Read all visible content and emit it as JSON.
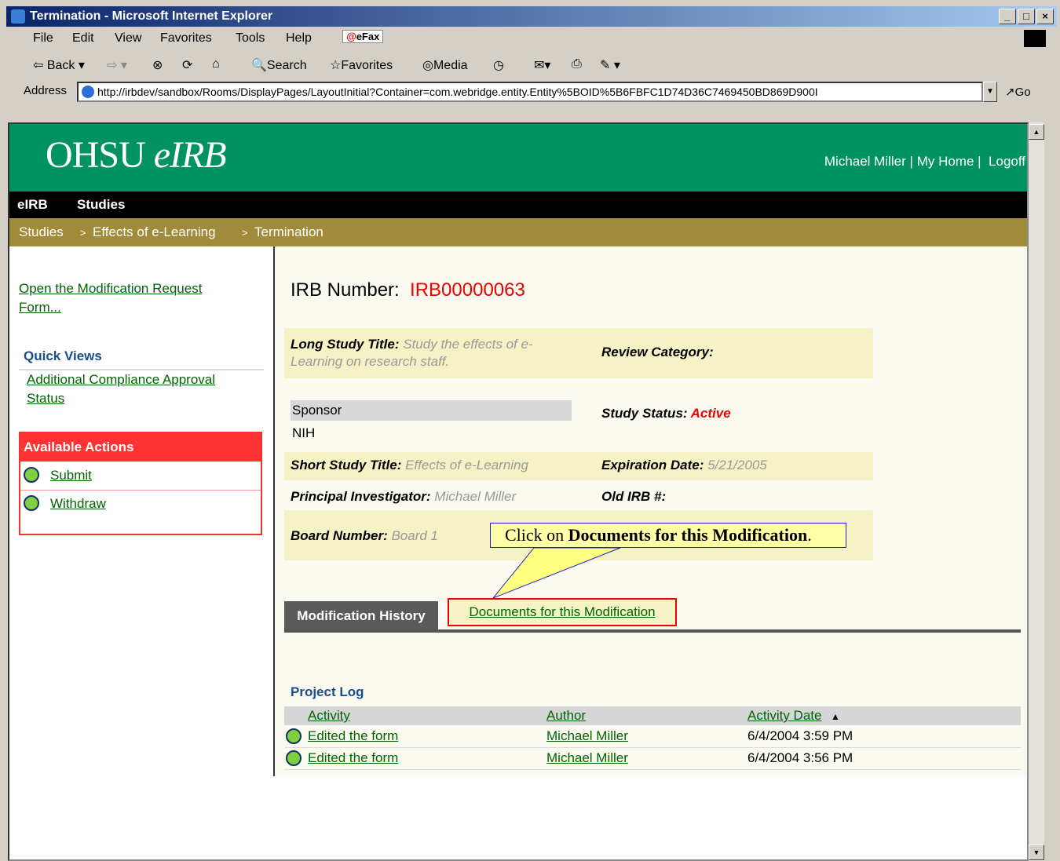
{
  "window": {
    "title": "Termination - Microsoft Internet Explorer"
  },
  "menu": [
    "File",
    "Edit",
    "View",
    "Favorites",
    "Tools",
    "Help"
  ],
  "efax_label": "eFax",
  "toolbar": {
    "back": "Back",
    "search": "Search",
    "favorites": "Favorites",
    "media": "Media"
  },
  "address": {
    "label": "Address",
    "url": "http://irbdev/sandbox/Rooms/DisplayPages/LayoutInitial?Container=com.webridge.entity.Entity%5BOID%5B6FBFC1D74D36C7469450BD869D900I",
    "go": "Go"
  },
  "site": {
    "logo_main": "OHSU",
    "logo_italic": "eIRB",
    "user": "Michael Miller",
    "myhome": "My Home",
    "sep1": "|",
    "sep2": "|",
    "logoff": "Logoff"
  },
  "nav": {
    "item1": "eIRB",
    "item2": "Studies"
  },
  "breadcrumb": {
    "a": "Studies",
    "b": "Effects of e-Learning",
    "c": "Termination",
    "sep": ">"
  },
  "left": {
    "mod_link": "Open the Modification Request Form...",
    "quick_views": "Quick Views",
    "quick_link": "Additional Compliance Approval Status",
    "available_actions": "Available Actions",
    "actions": [
      "Submit",
      "Withdraw"
    ]
  },
  "main": {
    "irb_label": "IRB Number:",
    "irb_value": "IRB00000063",
    "long_title_label": "Long Study Title:",
    "long_title_value": "Study the effects of e-Learning on research staff.",
    "review_category": "Review Category:",
    "sponsor_label": "Sponsor",
    "sponsor_value": "NIH",
    "study_status_label": "Study Status:",
    "study_status_value": "Active",
    "short_title_label": "Short Study Title:",
    "short_title_value": "Effects of e-Learning",
    "expiration_label": "Expiration Date:",
    "expiration_value": "5/21/2005",
    "pi_label": "Principal Investigator:",
    "pi_value": "Michael  Miller",
    "old_irb_label": "Old IRB #:",
    "board_label": "Board Number:",
    "board_value": "Board 1",
    "callout_pre": "Click on ",
    "callout_bold": "Documents for this Modification",
    "callout_post": ".",
    "tab_history": "Modification History",
    "tab_docs": "Documents for this Modification",
    "project_log": "Project Log",
    "log_headers": [
      "Activity",
      "Author",
      "Activity Date"
    ],
    "log_rows": [
      {
        "activity": "Edited the form",
        "author": "Michael Miller",
        "date": "6/4/2004 3:59 PM"
      },
      {
        "activity": "Edited the form",
        "author": "Michael Miller",
        "date": "6/4/2004 3:56 PM"
      }
    ]
  },
  "colors": {
    "green": "#009260",
    "gold": "#a08b3a",
    "red": "#e00000",
    "band": "#f5f3c6"
  }
}
